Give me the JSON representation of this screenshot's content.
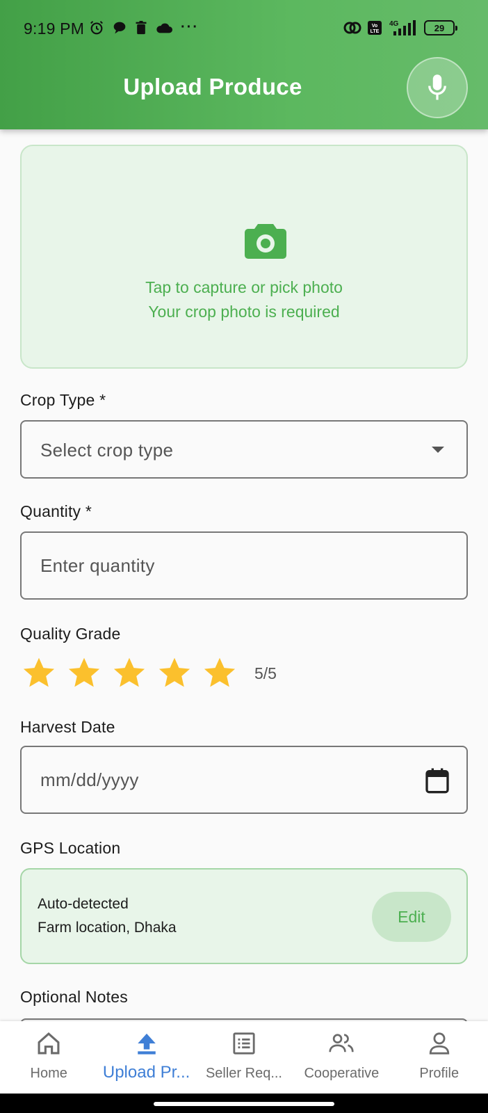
{
  "status_bar": {
    "time": "9:19 PM",
    "battery": "29",
    "network": "4G",
    "icons_left": [
      "alarm-icon",
      "chat-icon",
      "delete-icon",
      "cloud-icon",
      "more-dots-icon"
    ],
    "icons_right": [
      "hotspot-icon",
      "volte-icon",
      "signal-icon",
      "battery-icon"
    ],
    "dots": "···"
  },
  "app_bar": {
    "title": "Upload Produce",
    "mic_icon": "microphone-icon"
  },
  "photo": {
    "line1": "Tap to capture or pick photo",
    "line2": "Your crop photo is required",
    "icon": "camera-icon"
  },
  "crop_type": {
    "label": "Crop Type *",
    "placeholder": "Select crop type"
  },
  "quantity": {
    "label": "Quantity *",
    "placeholder": "Enter quantity"
  },
  "quality": {
    "label": "Quality Grade",
    "rating": 5,
    "max": 5,
    "rating_text": "5/5"
  },
  "harvest_date": {
    "label": "Harvest Date",
    "placeholder": "mm/dd/yyyy"
  },
  "gps": {
    "label": "GPS Location",
    "line1": "Auto-detected",
    "line2": "Farm location, Dhaka",
    "edit_label": "Edit"
  },
  "notes": {
    "label": "Optional Notes"
  },
  "bottom_nav": {
    "items": [
      {
        "label": "Home",
        "icon": "home-icon",
        "active": false
      },
      {
        "label": "Upload Pr...",
        "icon": "upload-icon",
        "active": true
      },
      {
        "label": "Seller Req...",
        "icon": "list-icon",
        "active": false
      },
      {
        "label": "Cooperative",
        "icon": "group-icon",
        "active": false
      },
      {
        "label": "Profile",
        "icon": "person-icon",
        "active": false
      }
    ]
  },
  "colors": {
    "primary_green": "#4caf50",
    "light_green": "#e8f5e9",
    "star_yellow": "#fbc02d",
    "active_blue": "#3f7fd6"
  }
}
